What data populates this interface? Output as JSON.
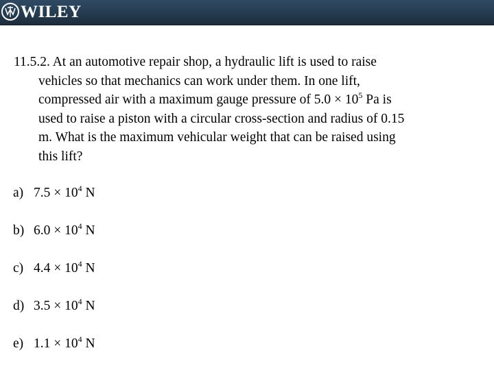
{
  "header": {
    "brand": "WILEY",
    "logo_icon": "wiley-logo-icon",
    "background_color": "#263d52"
  },
  "question": {
    "number": "11.5.2.",
    "lines": [
      "At an automotive repair shop, a hydraulic lift is used to raise",
      "vehicles so that mechanics can work under them.  In one lift,",
      "compressed air with a maximum gauge pressure of 5.0 × 10",
      "used to raise a piston with a circular cross-section and radius of 0.15",
      "m.  What is the maximum vehicular weight that can be raised using",
      "this lift?"
    ],
    "pressure_exponent": "5",
    "line3_suffix": " Pa is"
  },
  "options": [
    {
      "letter": "a)",
      "mantissa": "7.5 × 10",
      "exponent": "4",
      "unit": " N"
    },
    {
      "letter": "b)",
      "mantissa": "6.0 × 10",
      "exponent": "4",
      "unit": " N"
    },
    {
      "letter": "c)",
      "mantissa": "4.4 × 10",
      "exponent": "4",
      "unit": " N"
    },
    {
      "letter": "d)",
      "mantissa": "3.5 × 10",
      "exponent": "4",
      "unit": " N"
    },
    {
      "letter": "e)",
      "mantissa": "1.1 × 10",
      "exponent": "4",
      "unit": " N"
    }
  ]
}
